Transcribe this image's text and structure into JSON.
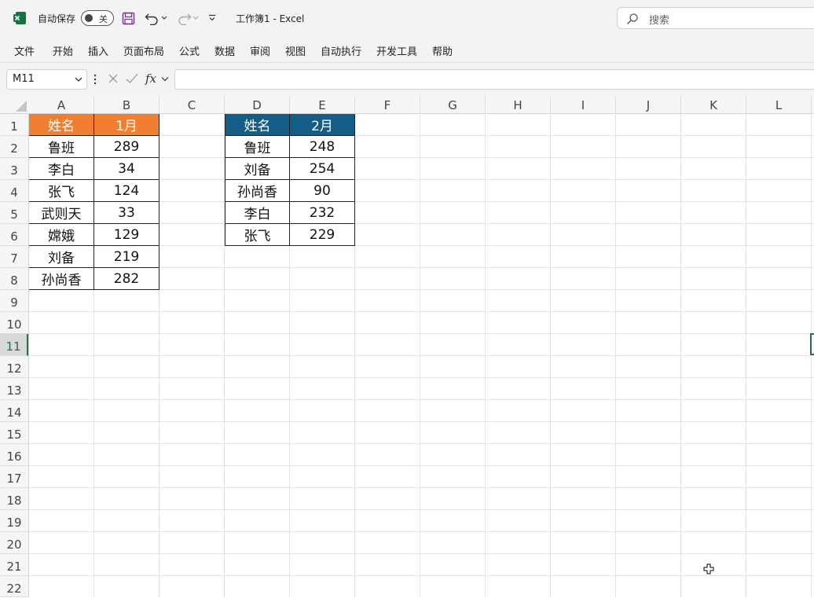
{
  "titlebar": {
    "autosave_label": "自动保存",
    "toggle_state": "关",
    "workbook_title": "工作簿1  -  Excel",
    "search_placeholder": "搜索"
  },
  "menu": [
    "文件",
    "开始",
    "插入",
    "页面布局",
    "公式",
    "数据",
    "审阅",
    "视图",
    "自动执行",
    "开发工具",
    "帮助"
  ],
  "formula_bar": {
    "name_box": "M11",
    "fx": "fx",
    "formula": ""
  },
  "columns": [
    "A",
    "B",
    "C",
    "D",
    "E",
    "F",
    "G",
    "H",
    "I",
    "J",
    "K",
    "L"
  ],
  "rows": [
    "1",
    "2",
    "3",
    "4",
    "5",
    "6",
    "7",
    "8",
    "9",
    "10",
    "11",
    "12",
    "13",
    "14",
    "15",
    "16",
    "17",
    "18",
    "19",
    "20",
    "21",
    "22"
  ],
  "selected_row": "11",
  "table1": {
    "headers": [
      "姓名",
      "1月"
    ],
    "rows": [
      [
        "鲁班",
        "289"
      ],
      [
        "李白",
        "34"
      ],
      [
        "张飞",
        "124"
      ],
      [
        "武则天",
        "33"
      ],
      [
        "嫦娥",
        "129"
      ],
      [
        "刘备",
        "219"
      ],
      [
        "孙尚香",
        "282"
      ]
    ]
  },
  "table2": {
    "headers": [
      "姓名",
      "2月"
    ],
    "rows": [
      [
        "鲁班",
        "248"
      ],
      [
        "刘备",
        "254"
      ],
      [
        "孙尚香",
        "90"
      ],
      [
        "李白",
        "232"
      ],
      [
        "张飞",
        "229"
      ]
    ]
  },
  "colors": {
    "orange_header": "#f17f31",
    "blue_header": "#145d86",
    "excel_green": "#217346"
  }
}
